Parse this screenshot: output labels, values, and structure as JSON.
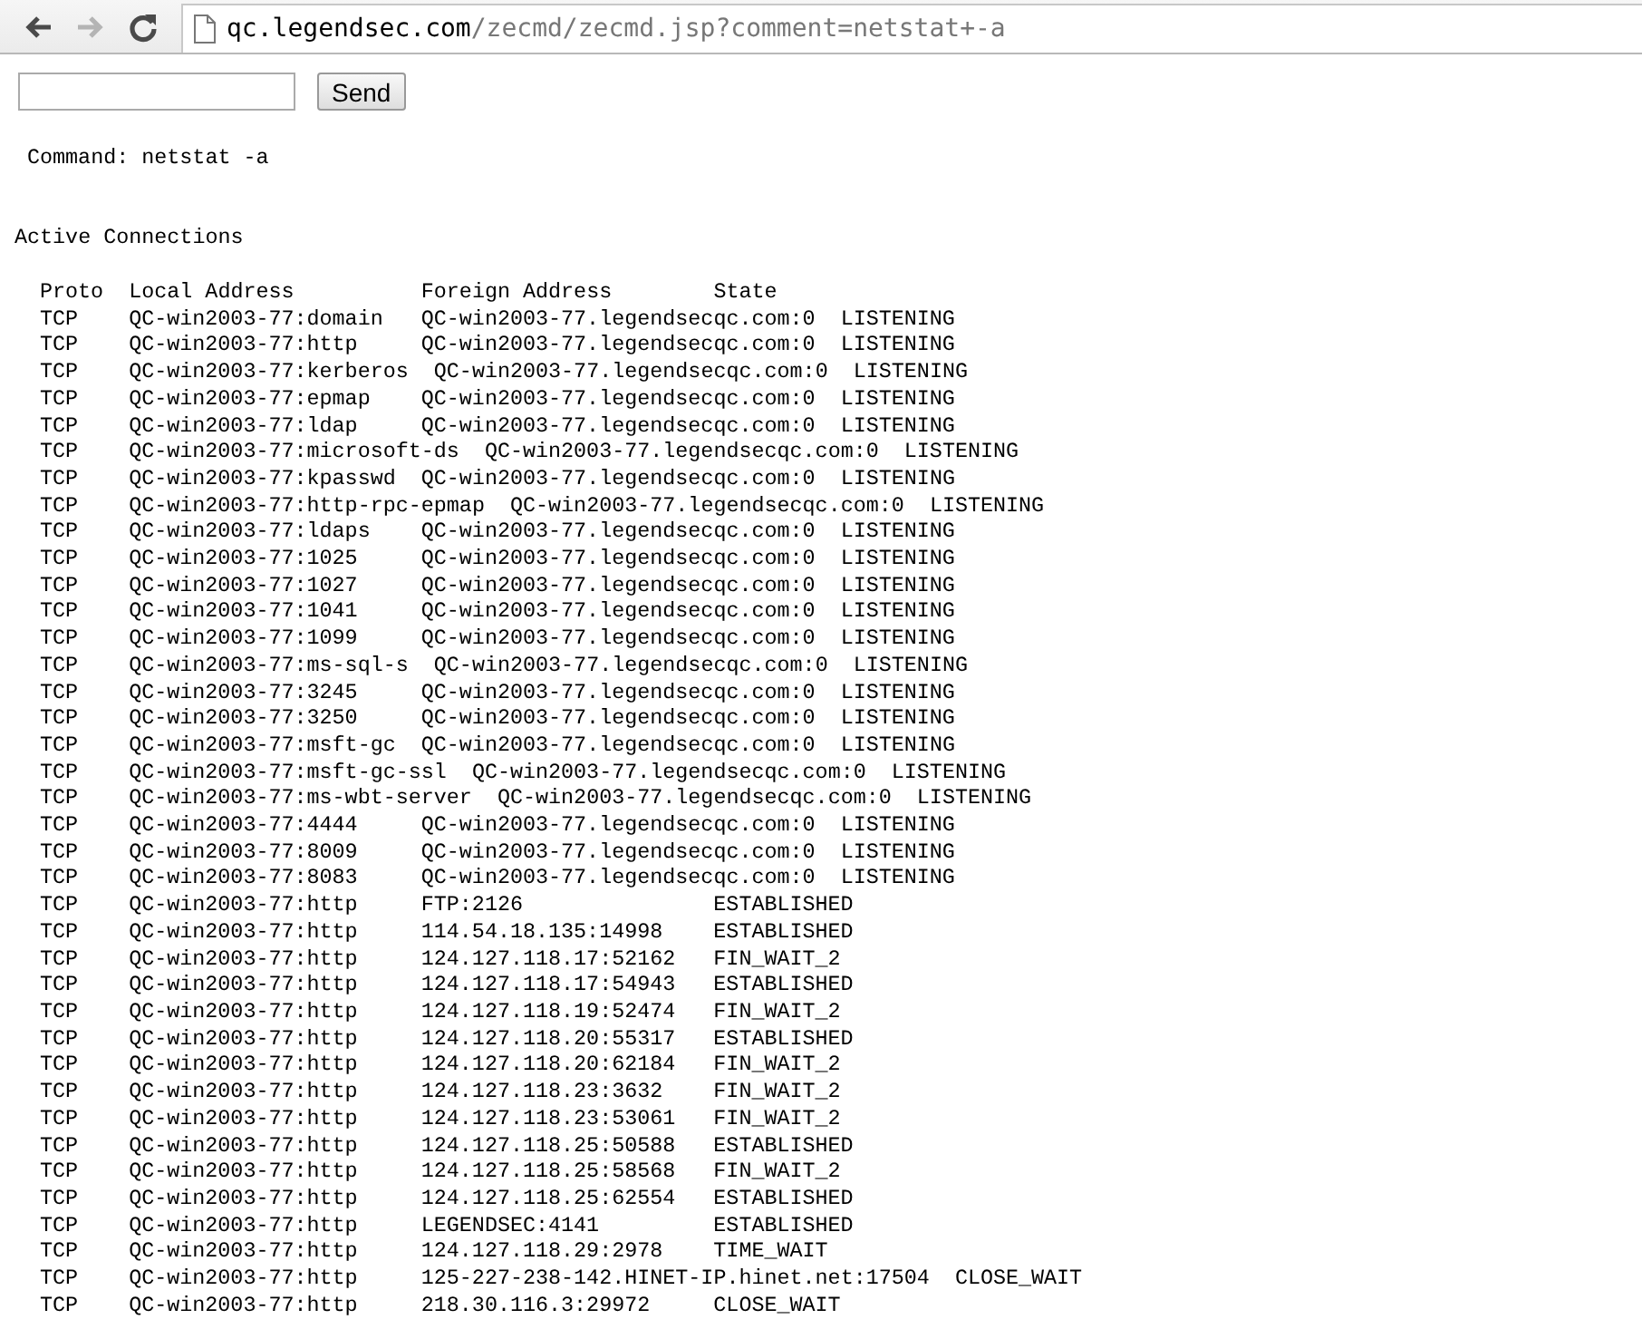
{
  "browser": {
    "nav": [
      {
        "kind": "back",
        "disabled": false
      },
      {
        "kind": "forward",
        "disabled": true
      },
      {
        "kind": "reload",
        "disabled": false
      }
    ],
    "url_host": "qc.legendsec.com",
    "url_path": "/zecmd/zecmd.jsp?comment=netstat+-a"
  },
  "form": {
    "button": "Send"
  },
  "command": "Command: netstat -a",
  "heading": "Active Connections",
  "columns": [
    "Proto",
    "Local Address",
    "Foreign Address",
    "State"
  ],
  "rows": [
    [
      "TCP",
      "QC-win2003-77:domain",
      "QC-win2003-77.legendsecqc.com:0",
      "LISTENING"
    ],
    [
      "TCP",
      "QC-win2003-77:http",
      "QC-win2003-77.legendsecqc.com:0",
      "LISTENING"
    ],
    [
      "TCP",
      "QC-win2003-77:kerberos",
      "QC-win2003-77.legendsecqc.com:0",
      "LISTENING"
    ],
    [
      "TCP",
      "QC-win2003-77:epmap",
      "QC-win2003-77.legendsecqc.com:0",
      "LISTENING"
    ],
    [
      "TCP",
      "QC-win2003-77:ldap",
      "QC-win2003-77.legendsecqc.com:0",
      "LISTENING"
    ],
    [
      "TCP",
      "QC-win2003-77:microsoft-ds",
      "QC-win2003-77.legendsecqc.com:0",
      "LISTENING"
    ],
    [
      "TCP",
      "QC-win2003-77:kpasswd",
      "QC-win2003-77.legendsecqc.com:0",
      "LISTENING"
    ],
    [
      "TCP",
      "QC-win2003-77:http-rpc-epmap",
      "QC-win2003-77.legendsecqc.com:0",
      "LISTENING"
    ],
    [
      "TCP",
      "QC-win2003-77:ldaps",
      "QC-win2003-77.legendsecqc.com:0",
      "LISTENING"
    ],
    [
      "TCP",
      "QC-win2003-77:1025",
      "QC-win2003-77.legendsecqc.com:0",
      "LISTENING"
    ],
    [
      "TCP",
      "QC-win2003-77:1027",
      "QC-win2003-77.legendsecqc.com:0",
      "LISTENING"
    ],
    [
      "TCP",
      "QC-win2003-77:1041",
      "QC-win2003-77.legendsecqc.com:0",
      "LISTENING"
    ],
    [
      "TCP",
      "QC-win2003-77:1099",
      "QC-win2003-77.legendsecqc.com:0",
      "LISTENING"
    ],
    [
      "TCP",
      "QC-win2003-77:ms-sql-s",
      "QC-win2003-77.legendsecqc.com:0",
      "LISTENING"
    ],
    [
      "TCP",
      "QC-win2003-77:3245",
      "QC-win2003-77.legendsecqc.com:0",
      "LISTENING"
    ],
    [
      "TCP",
      "QC-win2003-77:3250",
      "QC-win2003-77.legendsecqc.com:0",
      "LISTENING"
    ],
    [
      "TCP",
      "QC-win2003-77:msft-gc",
      "QC-win2003-77.legendsecqc.com:0",
      "LISTENING"
    ],
    [
      "TCP",
      "QC-win2003-77:msft-gc-ssl",
      "QC-win2003-77.legendsecqc.com:0",
      "LISTENING"
    ],
    [
      "TCP",
      "QC-win2003-77:ms-wbt-server",
      "QC-win2003-77.legendsecqc.com:0",
      "LISTENING"
    ],
    [
      "TCP",
      "QC-win2003-77:4444",
      "QC-win2003-77.legendsecqc.com:0",
      "LISTENING"
    ],
    [
      "TCP",
      "QC-win2003-77:8009",
      "QC-win2003-77.legendsecqc.com:0",
      "LISTENING"
    ],
    [
      "TCP",
      "QC-win2003-77:8083",
      "QC-win2003-77.legendsecqc.com:0",
      "LISTENING"
    ],
    [
      "TCP",
      "QC-win2003-77:http",
      "FTP:2126",
      "ESTABLISHED"
    ],
    [
      "TCP",
      "QC-win2003-77:http",
      "114.54.18.135:14998",
      "ESTABLISHED"
    ],
    [
      "TCP",
      "QC-win2003-77:http",
      "124.127.118.17:52162",
      "FIN_WAIT_2"
    ],
    [
      "TCP",
      "QC-win2003-77:http",
      "124.127.118.17:54943",
      "ESTABLISHED"
    ],
    [
      "TCP",
      "QC-win2003-77:http",
      "124.127.118.19:52474",
      "FIN_WAIT_2"
    ],
    [
      "TCP",
      "QC-win2003-77:http",
      "124.127.118.20:55317",
      "ESTABLISHED"
    ],
    [
      "TCP",
      "QC-win2003-77:http",
      "124.127.118.20:62184",
      "FIN_WAIT_2"
    ],
    [
      "TCP",
      "QC-win2003-77:http",
      "124.127.118.23:3632",
      "FIN_WAIT_2"
    ],
    [
      "TCP",
      "QC-win2003-77:http",
      "124.127.118.23:53061",
      "FIN_WAIT_2"
    ],
    [
      "TCP",
      "QC-win2003-77:http",
      "124.127.118.25:50588",
      "ESTABLISHED"
    ],
    [
      "TCP",
      "QC-win2003-77:http",
      "124.127.118.25:58568",
      "FIN_WAIT_2"
    ],
    [
      "TCP",
      "QC-win2003-77:http",
      "124.127.118.25:62554",
      "ESTABLISHED"
    ],
    [
      "TCP",
      "QC-win2003-77:http",
      "LEGENDSEC:4141",
      "ESTABLISHED"
    ],
    [
      "TCP",
      "QC-win2003-77:http",
      "124.127.118.29:2978",
      "TIME_WAIT"
    ],
    [
      "TCP",
      "QC-win2003-77:http",
      "125-227-238-142.HINET-IP.hinet.net:17504",
      "CLOSE_WAIT"
    ],
    [
      "TCP",
      "QC-win2003-77:http",
      "218.30.116.3:29972",
      "CLOSE_WAIT"
    ]
  ]
}
